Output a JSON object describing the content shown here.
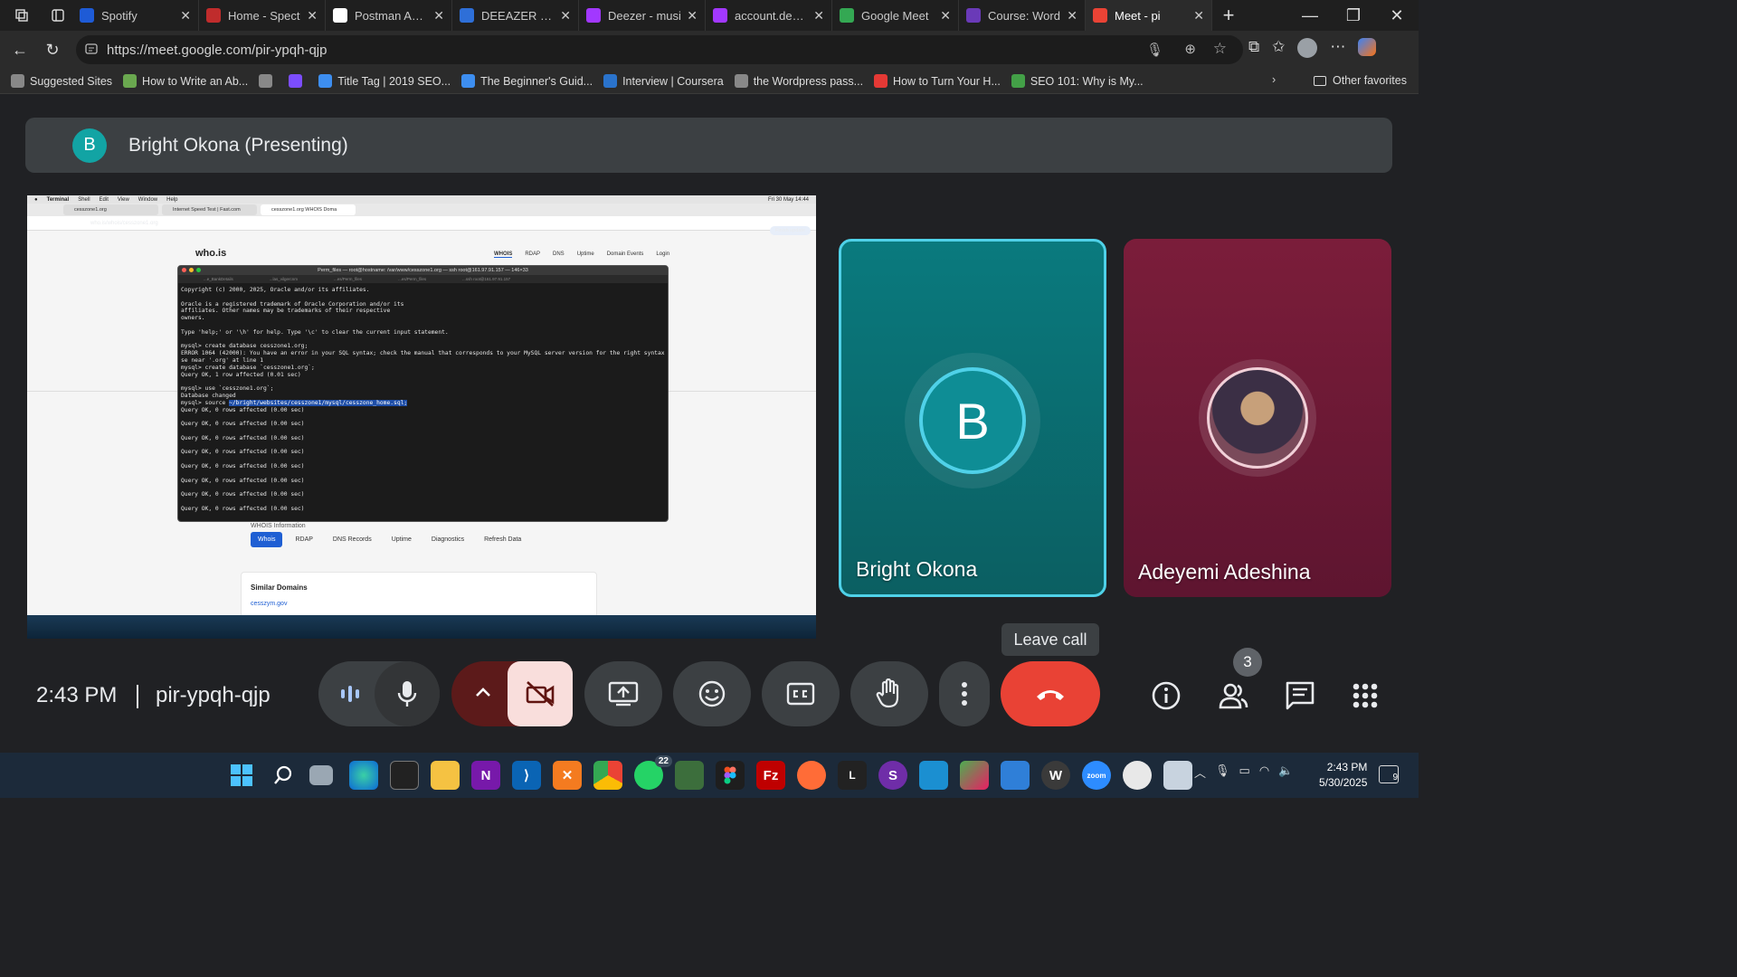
{
  "browser": {
    "tabs": [
      {
        "title": "Spotify",
        "color": "#1e5bd6"
      },
      {
        "title": "Home - Spect",
        "color": "#c02c2c"
      },
      {
        "title": "Postman API F",
        "color": "#ffffff"
      },
      {
        "title": "DEEAZER - Sea",
        "color": "#2e6fd8"
      },
      {
        "title": "Deezer - musi",
        "color": "#a238ff"
      },
      {
        "title": "account.deeze",
        "color": "#a238ff"
      },
      {
        "title": "Google Meet",
        "color": "#34a853"
      },
      {
        "title": "Course: Word",
        "color": "#6a3ab8"
      },
      {
        "title": "Meet - pi",
        "color": "#ea4335",
        "active": true
      }
    ],
    "new_tab": "+",
    "url": "https://meet.google.com/pir-ypqh-qjp",
    "bookmarks": [
      {
        "label": "Suggested Sites",
        "color": "#888"
      },
      {
        "label": "How to Write an Ab...",
        "color": "#6aa84f"
      },
      {
        "label": "",
        "color": "#888"
      },
      {
        "label": "",
        "color": "#7c4dff"
      },
      {
        "label": "Title Tag | 2019 SEO...",
        "color": "#3d8ef0"
      },
      {
        "label": "The Beginner's Guid...",
        "color": "#3d8ef0"
      },
      {
        "label": "Interview | Coursera",
        "color": "#2a73cc"
      },
      {
        "label": "the Wordpress pass...",
        "color": "#888"
      },
      {
        "label": "How to Turn Your H...",
        "color": "#e53935"
      },
      {
        "label": "SEO 101: Why is My...",
        "color": "#43a047"
      }
    ],
    "other_favorites": "Other favorites"
  },
  "meet": {
    "presenter_initial": "B",
    "presenter_banner": "Bright Okona (Presenting)",
    "participants": [
      {
        "name": "Bright Okona",
        "initial": "B",
        "speaking": true
      },
      {
        "name": "Adeyemi Adeshina",
        "initial": ""
      }
    ],
    "leave_tooltip": "Leave call",
    "time": "2:43 PM",
    "meeting_code": "pir-ypqh-qjp",
    "people_count": "3"
  },
  "shared_screen": {
    "mac_menu": [
      "Terminal",
      "Shell",
      "Edit",
      "View",
      "Window",
      "Help"
    ],
    "mac_clock": "Fri 30 May  14:44",
    "mac_tabs": [
      "cesszone1.org",
      "Internet Speed Test | Fast.com",
      "cesszone1.org WHOIS Doma"
    ],
    "mac_url": "who.is/whois/cesszone1.org",
    "finish_update": "Finish update",
    "site_title": "who.is",
    "site_nav": [
      "WHOIS",
      "RDAP",
      "DNS",
      "Uptime",
      "Domain Events",
      "Login"
    ],
    "terminal_title": "Perm_files — root@hostname: /var/www/cesszone1.org — ssh root@161.97.91.157 — 146×33",
    "terminal_tabs": [
      "...e_BankDetails",
      "...las_vilgercnm",
      "...es/Perm_files",
      "...es/Perm_files",
      "...ssh root@161.97.91.157"
    ],
    "terminal_lines": [
      "Copyright (c) 2000, 2025, Oracle and/or its affiliates.",
      "",
      "Oracle is a registered trademark of Oracle Corporation and/or its",
      "affiliates. Other names may be trademarks of their respective",
      "owners.",
      "",
      "Type 'help;' or '\\h' for help. Type '\\c' to clear the current input statement.",
      "",
      "mysql> create database cesszone1.org;",
      "ERROR 1064 (42000): You have an error in your SQL syntax; check the manual that corresponds to your MySQL server version for the right syntax to u",
      "se near '.org' at line 1",
      "mysql> create database `cesszone1.org`;",
      "Query OK, 1 row affected (0.01 sec)",
      "",
      "mysql> use `cesszone1.org`;",
      "Database changed"
    ],
    "terminal_source_prefix": "mysql> source ",
    "terminal_source_path": "~/bright/websites/cesszone1/mysql/cesszone_home.sql;",
    "terminal_tail": [
      "Query OK, 0 rows affected (0.00 sec)",
      "",
      "Query OK, 0 rows affected (0.00 sec)",
      "",
      "Query OK, 0 rows affected (0.00 sec)",
      "",
      "Query OK, 0 rows affected (0.00 sec)",
      "",
      "Query OK, 0 rows affected (0.00 sec)",
      "",
      "Query OK, 0 rows affected (0.00 sec)",
      "",
      "Query OK, 0 rows affected (0.00 sec)",
      "",
      "Query OK, 0 rows affected (0.00 sec)"
    ],
    "whois_info": "WHOIS Information",
    "whois_tabs": [
      "Whois",
      "RDAP",
      "DNS Records",
      "Uptime",
      "Diagnostics",
      "Refresh Data"
    ],
    "similar_domains": "Similar Domains",
    "similar_link": "cesszym.gov"
  },
  "taskbar": {
    "whatsapp_badge": "22",
    "time": "2:43 PM",
    "date": "5/30/2025",
    "notifications": "9"
  }
}
